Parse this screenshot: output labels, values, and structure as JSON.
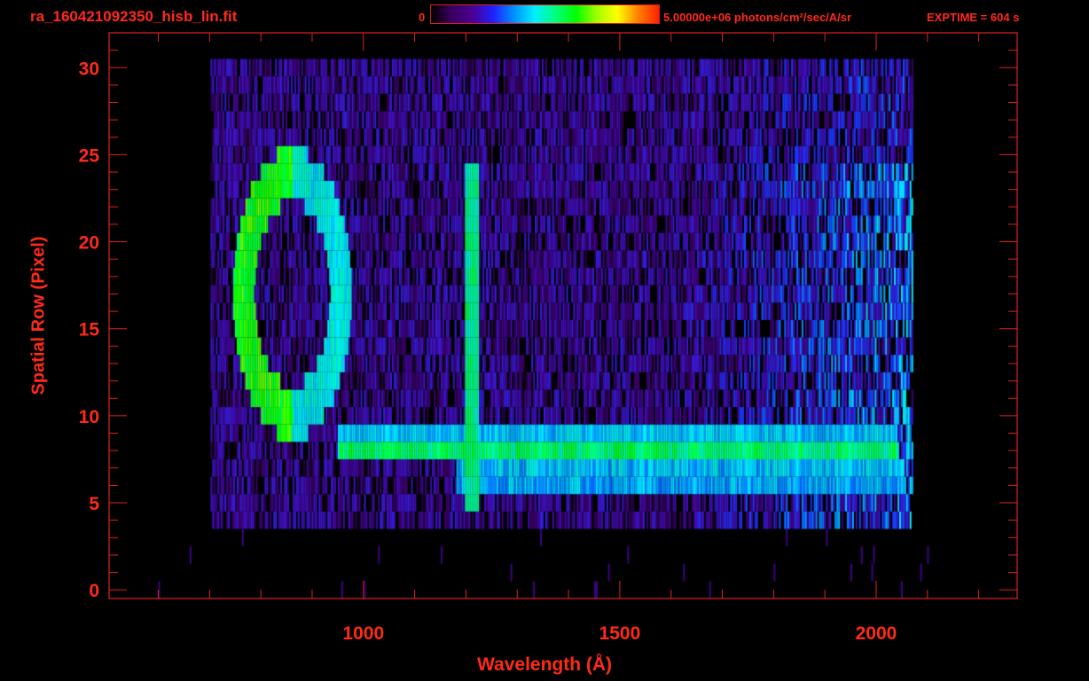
{
  "header": {
    "filename": "ra_160421092350_hisb_lin.fit",
    "colorbar_min": "0",
    "colorbar_max_label": "5.00000e+06 photons/cm²/sec/A/sr",
    "exptime": "EXPTIME = 604 s"
  },
  "chart_data": {
    "type": "heatmap",
    "title": "ra_160421092350_hisb_lin.fit",
    "xlabel": "Wavelength (Å)",
    "ylabel": "Spatial Row (Pixel)",
    "xlim": [
      504,
      2275
    ],
    "ylim": [
      -0.5,
      32
    ],
    "x_ticks": [
      1000,
      1500,
      2000
    ],
    "x_tick_labels": [
      "1000",
      "1500",
      "2000"
    ],
    "x_minor_step": 100,
    "y_ticks": [
      0,
      5,
      10,
      15,
      20,
      25,
      30
    ],
    "y_tick_labels": [
      "0",
      "5",
      "10",
      "15",
      "20",
      "25",
      "30"
    ],
    "colorbar": {
      "min": 0,
      "max": 5000000,
      "units": "photons/cm2/sec/A/sr",
      "colormap": "rainbow"
    },
    "features": [
      {
        "name": "ring",
        "center_wavelength": 860,
        "center_row": 17,
        "wavelength_radius": 95,
        "row_radius": 6.8,
        "intensity": 0.62
      },
      {
        "name": "lyman-alpha-line",
        "wavelength": 1210,
        "rows": [
          5,
          24
        ],
        "intensity": 0.6
      },
      {
        "name": "band-upper",
        "wavelength_range": [
          950,
          2040
        ],
        "rows": [
          8,
          9
        ],
        "intensity": 0.58
      },
      {
        "name": "band-lower",
        "wavelength_range": [
          1180,
          2050
        ],
        "rows": [
          6,
          7
        ],
        "intensity": 0.5
      },
      {
        "name": "background-noise",
        "wavelength_range": [
          700,
          2070
        ],
        "rows": [
          4,
          30
        ],
        "intensity": 0.18
      }
    ]
  }
}
